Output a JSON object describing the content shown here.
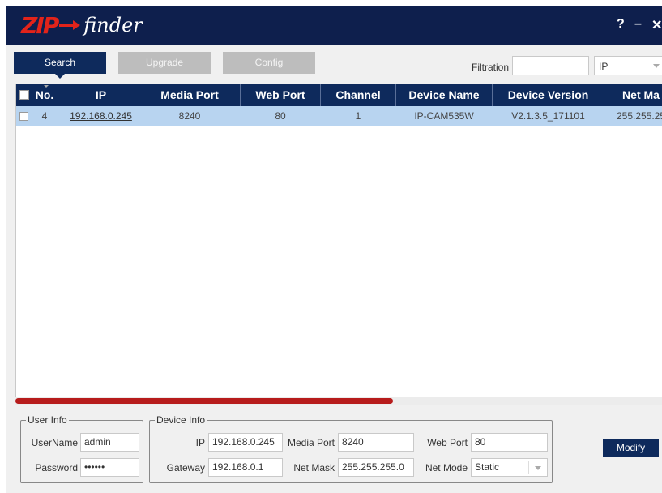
{
  "app": {
    "logo_zip": "ZIP",
    "logo_finder": "finder"
  },
  "window_controls": {
    "help": "?",
    "minimize": "–",
    "close": "✕"
  },
  "toolbar": {
    "search_label": "Search",
    "upgrade_label": "Upgrade",
    "config_label": "Config",
    "filtration_label": "Filtration",
    "filtration_value": "",
    "filter_type": "IP"
  },
  "table": {
    "headers": [
      "No.",
      "IP",
      "Media Port",
      "Web Port",
      "Channel",
      "Device Name",
      "Device Version",
      "Net Ma"
    ],
    "rows": [
      {
        "no": "4",
        "ip": "192.168.0.245",
        "media_port": "8240",
        "web_port": "80",
        "channel": "1",
        "device_name": "IP-CAM535W",
        "device_version": "V2.1.3.5_171101",
        "net_mask": "255.255.25"
      }
    ]
  },
  "user_info": {
    "title": "User Info",
    "username_label": "UserName",
    "username_value": "admin",
    "password_label": "Password",
    "password_value": "••••••"
  },
  "device_info": {
    "title": "Device Info",
    "ip_label": "IP",
    "ip_value": "192.168.0.245",
    "media_port_label": "Media Port",
    "media_port_value": "8240",
    "web_port_label": "Web Port",
    "web_port_value": "80",
    "gateway_label": "Gateway",
    "gateway_value": "192.168.0.1",
    "net_mask_label": "Net Mask",
    "net_mask_value": "255.255.255.0",
    "net_mode_label": "Net Mode",
    "net_mode_value": "Static"
  },
  "modify_label": "Modify",
  "colors": {
    "titlebar": "#0e1f4d",
    "accent": "#0e2a5c",
    "logo_red": "#e2231a",
    "row_selected": "#b8d4f0",
    "scrollbar": "#b71c1c"
  }
}
